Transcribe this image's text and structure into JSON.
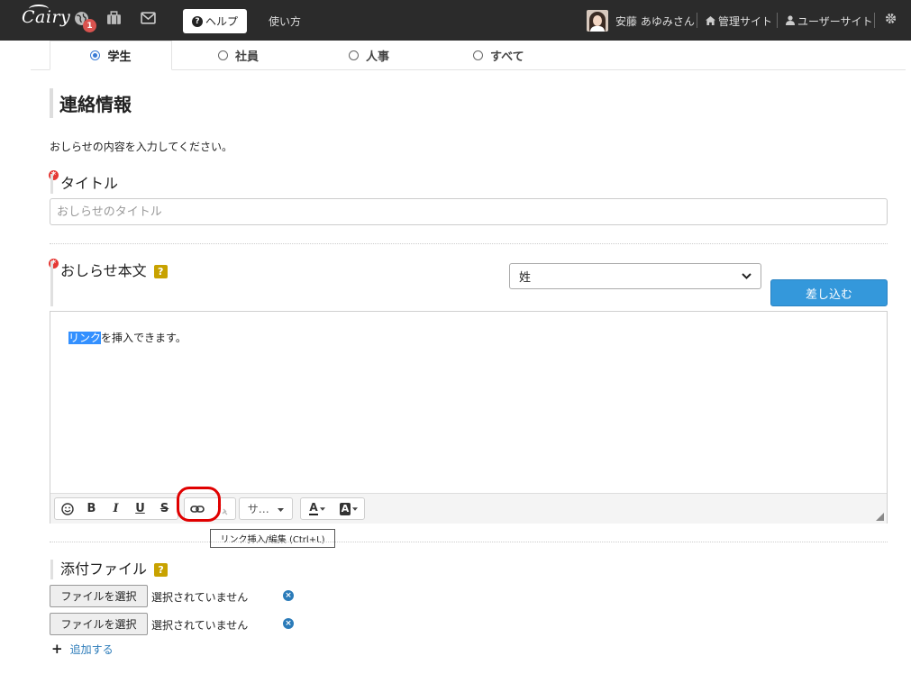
{
  "nav": {
    "logo": "Cairy",
    "notification_count": "1",
    "help_label": "ヘルプ",
    "howto_label": "使い方",
    "user_name": "安藤 あゆみさん",
    "admin_site_label": "管理サイト",
    "user_site_label": "ユーザーサイト"
  },
  "tabs": [
    {
      "label": "学生",
      "active": true
    },
    {
      "label": "社員",
      "active": false
    },
    {
      "label": "人事",
      "active": false
    },
    {
      "label": "すべて",
      "active": false
    }
  ],
  "section_title": "連絡情報",
  "intro_text": "おしらせの内容を入力してください。",
  "title_field": {
    "required_mark": "*",
    "label": "タイトル",
    "placeholder": "おしらせのタイトル",
    "value": ""
  },
  "body_field": {
    "required_mark": "*",
    "label": "おしらせ本文",
    "help_mark": "?",
    "merge_select_value": "姓",
    "insert_button_label": "差し込む",
    "content_highlighted": "リンク",
    "content_rest": "を挿入できます。"
  },
  "toolbar": {
    "emoji": "☺",
    "bold": "B",
    "italic": "I",
    "underline": "U",
    "strike": "S",
    "size_label": "サ…",
    "font_color": "A",
    "bg_color": "A",
    "link_tooltip": "リンク挿入/編集 (Ctrl+L)"
  },
  "attachments": {
    "label": "添付ファイル",
    "help_mark": "?",
    "choose_label": "ファイルを選択",
    "no_file_text": "選択されていません",
    "add_label": "追加する",
    "rows": 2
  },
  "colors": {
    "topbar": "#2b2b2b",
    "accent": "#3498db",
    "required": "#e53935",
    "help": "#c8a200",
    "highlight": "#e00000"
  }
}
